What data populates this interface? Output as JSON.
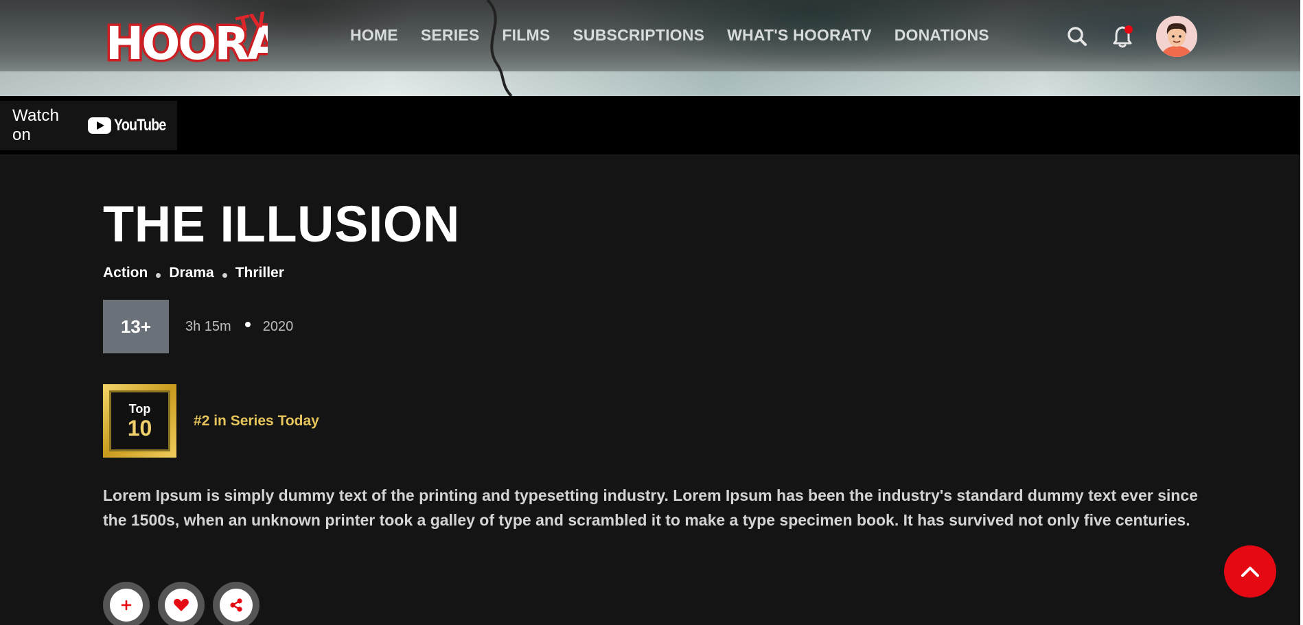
{
  "header": {
    "logo_text": "HOORA",
    "logo_tv": "TV",
    "nav": [
      {
        "label": "HOME"
      },
      {
        "label": "SERIES"
      },
      {
        "label": "FILMS"
      },
      {
        "label": "SUBSCRIPTIONS"
      },
      {
        "label": "WHAT'S HOORATV"
      },
      {
        "label": "DONATIONS"
      }
    ],
    "has_notification": true
  },
  "video": {
    "watch_on_label": "Watch on",
    "platform": "YouTube"
  },
  "show": {
    "title": "THE ILLUSION",
    "genres": [
      "Action",
      "Drama",
      "Thriller"
    ],
    "rating": "13+",
    "duration": "3h 15m",
    "year": "2020",
    "top10": {
      "top_label": "Top",
      "number": "10",
      "text": "#2 in Series Today"
    },
    "description": "Lorem Ipsum is simply dummy text of the printing and typesetting industry. Lorem Ipsum has been the industry's standard dummy text ever since the 1500s, when an unknown printer took a galley of type and scrambled it to make a type specimen book. It has survived not only five centuries."
  },
  "actions": [
    {
      "icon": "plus-icon"
    },
    {
      "icon": "heart-icon"
    },
    {
      "icon": "share-icon"
    }
  ],
  "colors": {
    "accent": "#e50914",
    "background": "#141414",
    "gold": "#e6c55c",
    "rating_badge": "#6b7178"
  },
  "icons": {
    "search": "search-icon",
    "notification": "bell-icon",
    "scroll_top": "chevron-up-icon"
  }
}
